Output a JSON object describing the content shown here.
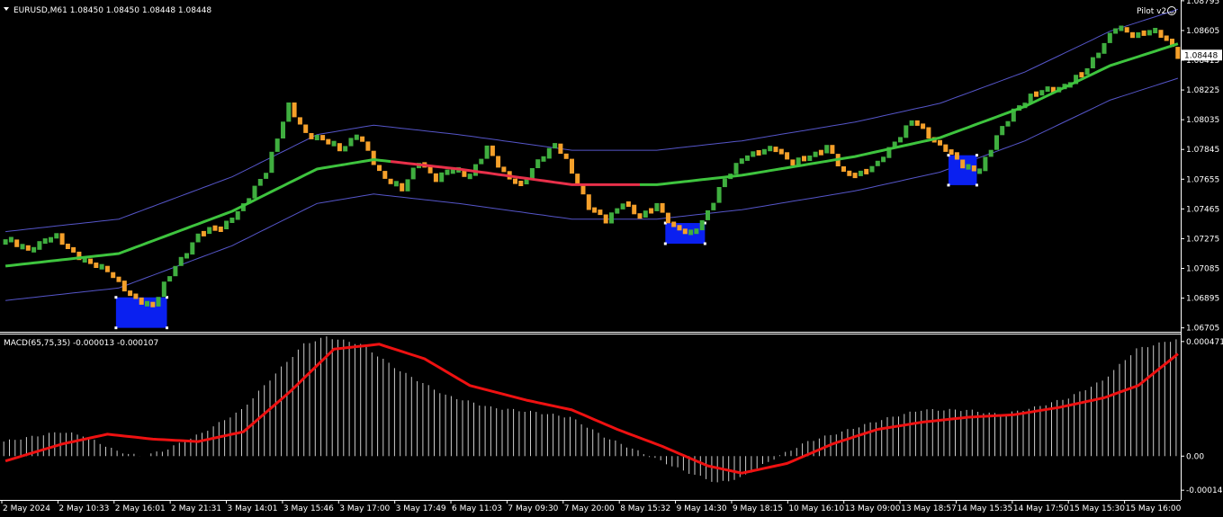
{
  "header": {
    "main_title": "EURUSD,M61  1.08450 1.08450 1.08448 1.08448",
    "indicator_title": "MACD(65,75,35) -0.000013 -0.000107",
    "ea_name": "Pilot v2"
  },
  "colors": {
    "background": "#000000",
    "bull_bar": "#3fae3f",
    "bear_bar": "#f5a02a",
    "ma_rising": "#3ec43e",
    "ma_falling": "#e8304a",
    "envelope": "#5555c8",
    "signal_box": "#0a20f0",
    "macd_hist": "#cccccc",
    "macd_signal": "#ee1111",
    "axis_text": "#ffffff",
    "price_tag_bg": "#ffffff"
  },
  "chart_data": [
    {
      "type": "bar",
      "name": "price",
      "symbol": "EURUSD",
      "timeframe": "M61",
      "ylim": [
        1.0668,
        1.088
      ],
      "y_ticks": [
        "1.08795",
        "1.08605",
        "1.08415",
        "1.08225",
        "1.08035",
        "1.07845",
        "1.07655",
        "1.07465",
        "1.07275",
        "1.07085",
        "1.06895",
        "1.06705"
      ],
      "current_price": "1.08448",
      "x_ticks": [
        "2 May 2024",
        "2 May 10:33",
        "2 May 16:01",
        "2 May 21:31",
        "3 May 14:01",
        "3 May 15:46",
        "3 May 17:00",
        "3 May 17:49",
        "6 May 11:03",
        "7 May 09:30",
        "7 May 20:00",
        "8 May 15:32",
        "9 May 14:30",
        "9 May 18:15",
        "10 May 16:10",
        "13 May 09:00",
        "13 May 18:57",
        "14 May 15:35",
        "14 May 17:50",
        "15 May 15:30",
        "15 May 16:00"
      ],
      "close_keypoints": [
        [
          0,
          1.0726
        ],
        [
          4,
          1.0721
        ],
        [
          9,
          1.0729
        ],
        [
          14,
          1.0712
        ],
        [
          18,
          1.0708
        ],
        [
          22,
          1.069
        ],
        [
          26,
          1.0685
        ],
        [
          30,
          1.071
        ],
        [
          34,
          1.073
        ],
        [
          38,
          1.0735
        ],
        [
          42,
          1.0748
        ],
        [
          46,
          1.0772
        ],
        [
          50,
          1.0812
        ],
        [
          53,
          1.0795
        ],
        [
          56,
          1.079
        ],
        [
          59,
          1.0785
        ],
        [
          62,
          1.0794
        ],
        [
          66,
          1.077
        ],
        [
          70,
          1.0758
        ],
        [
          73,
          1.0778
        ],
        [
          76,
          1.0765
        ],
        [
          79,
          1.0772
        ],
        [
          82,
          1.0768
        ],
        [
          85,
          1.0785
        ],
        [
          88,
          1.077
        ],
        [
          91,
          1.076
        ],
        [
          94,
          1.0778
        ],
        [
          97,
          1.0788
        ],
        [
          100,
          1.077
        ],
        [
          103,
          1.0748
        ],
        [
          106,
          1.0738
        ],
        [
          109,
          1.0752
        ],
        [
          112,
          1.074
        ],
        [
          115,
          1.075
        ],
        [
          118,
          1.0734
        ],
        [
          121,
          1.073
        ],
        [
          124,
          1.0745
        ],
        [
          127,
          1.0765
        ],
        [
          130,
          1.078
        ],
        [
          133,
          1.0782
        ],
        [
          136,
          1.0786
        ],
        [
          139,
          1.0775
        ],
        [
          142,
          1.078
        ],
        [
          145,
          1.0787
        ],
        [
          148,
          1.0768
        ],
        [
          151,
          1.077
        ],
        [
          154,
          1.0775
        ],
        [
          157,
          1.079
        ],
        [
          160,
          1.0803
        ],
        [
          163,
          1.0793
        ],
        [
          166,
          1.0785
        ],
        [
          169,
          1.0773
        ],
        [
          172,
          1.0772
        ],
        [
          175,
          1.0792
        ],
        [
          178,
          1.081
        ],
        [
          181,
          1.0818
        ],
        [
          184,
          1.0823
        ],
        [
          187,
          1.0825
        ],
        [
          190,
          1.0832
        ],
        [
          193,
          1.0848
        ],
        [
          196,
          1.0862
        ],
        [
          199,
          1.0858
        ],
        [
          202,
          1.086
        ],
        [
          205,
          1.0855
        ],
        [
          207,
          1.0845
        ]
      ],
      "ma_keypoints": [
        [
          0,
          1.071
        ],
        [
          20,
          1.0718
        ],
        [
          40,
          1.0745
        ],
        [
          55,
          1.0772
        ],
        [
          65,
          1.0778
        ],
        [
          80,
          1.0772
        ],
        [
          100,
          1.0762
        ],
        [
          115,
          1.0762
        ],
        [
          130,
          1.0768
        ],
        [
          150,
          1.078
        ],
        [
          165,
          1.0792
        ],
        [
          180,
          1.0812
        ],
        [
          195,
          1.0838
        ],
        [
          207,
          1.0852
        ]
      ],
      "ma_falling_range": [
        68,
        112
      ],
      "envelope_width": 0.0022,
      "signal_boxes": [
        {
          "start": 20,
          "end": 28,
          "high": 1.069,
          "low": 1.06705
        },
        {
          "start": 117,
          "end": 123,
          "high": 1.07375,
          "low": 1.07243
        },
        {
          "start": 167,
          "end": 171,
          "high": 1.07808,
          "low": 1.07617
        }
      ]
    },
    {
      "type": "bar",
      "name": "MACD",
      "ylim": [
        -0.00018,
        0.0005
      ],
      "y_ticks": [
        "0.000471",
        "0.00",
        "-0.00014"
      ],
      "hist_keypoints": [
        [
          0,
          6e-05
        ],
        [
          10,
          0.0001
        ],
        [
          14,
          8.5e-05
        ],
        [
          20,
          2e-05
        ],
        [
          24,
          0.0
        ],
        [
          28,
          2e-05
        ],
        [
          35,
          9.5e-05
        ],
        [
          42,
          0.00019
        ],
        [
          48,
          0.00034
        ],
        [
          53,
          0.00046
        ],
        [
          57,
          0.00049
        ],
        [
          63,
          0.00046
        ],
        [
          70,
          0.00035
        ],
        [
          78,
          0.00025
        ],
        [
          86,
          0.0002
        ],
        [
          94,
          0.00018
        ],
        [
          100,
          0.00016
        ],
        [
          106,
          8e-05
        ],
        [
          112,
          2e-05
        ],
        [
          120,
          -6e-05
        ],
        [
          126,
          -0.00011
        ],
        [
          130,
          -9e-05
        ],
        [
          136,
          -1e-05
        ],
        [
          142,
          6e-05
        ],
        [
          148,
          0.0001
        ],
        [
          155,
          0.00015
        ],
        [
          162,
          0.00019
        ],
        [
          170,
          0.00019
        ],
        [
          176,
          0.00017
        ],
        [
          182,
          0.0002
        ],
        [
          188,
          0.00024
        ],
        [
          194,
          0.00031
        ],
        [
          200,
          0.00044
        ],
        [
          207,
          0.00048
        ]
      ],
      "signal_keypoints": [
        [
          0,
          -2e-05
        ],
        [
          10,
          5e-05
        ],
        [
          18,
          9e-05
        ],
        [
          26,
          7e-05
        ],
        [
          34,
          6e-05
        ],
        [
          42,
          0.0001
        ],
        [
          50,
          0.00026
        ],
        [
          58,
          0.00044
        ],
        [
          66,
          0.00046
        ],
        [
          74,
          0.0004
        ],
        [
          82,
          0.00029
        ],
        [
          92,
          0.00023
        ],
        [
          100,
          0.00019
        ],
        [
          108,
          0.00011
        ],
        [
          116,
          4e-05
        ],
        [
          124,
          -4e-05
        ],
        [
          130,
          -7e-05
        ],
        [
          138,
          -3e-05
        ],
        [
          146,
          5e-05
        ],
        [
          154,
          0.00011
        ],
        [
          162,
          0.00014
        ],
        [
          170,
          0.00016
        ],
        [
          178,
          0.00017
        ],
        [
          186,
          0.0002
        ],
        [
          194,
          0.00024
        ],
        [
          200,
          0.00029
        ],
        [
          207,
          0.00042
        ]
      ]
    }
  ]
}
